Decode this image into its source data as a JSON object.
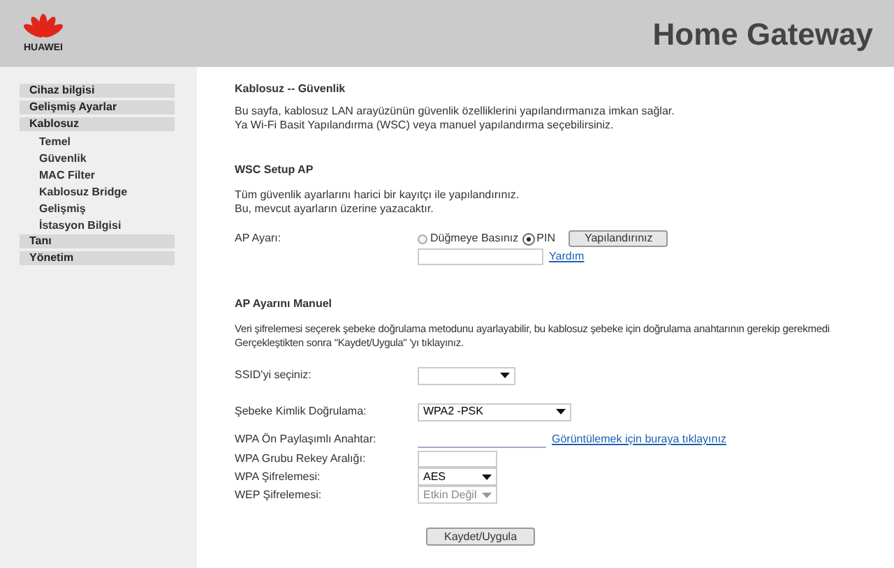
{
  "header": {
    "logo_text": "HUAWEI",
    "title": "Home Gateway"
  },
  "sidebar": {
    "items": [
      {
        "label": "Cihaz bilgisi"
      },
      {
        "label": "Gelişmiş Ayarlar"
      },
      {
        "label": "Kablosuz",
        "children": [
          {
            "label": "Temel"
          },
          {
            "label": "Güvenlik"
          },
          {
            "label": "MAC Filter"
          },
          {
            "label": "Kablosuz Bridge"
          },
          {
            "label": "Gelişmiş"
          },
          {
            "label": "İstasyon Bilgisi"
          }
        ]
      },
      {
        "label": "Tanı"
      },
      {
        "label": "Yönetim"
      }
    ]
  },
  "page": {
    "title": "Kablosuz -- Güvenlik",
    "description": [
      "Bu sayfa, kablosuz LAN arayüzünün güvenlik özelliklerini yapılandırmanıza imkan sağlar.",
      "Ya Wi-Fi Basit Yapılandırma (WSC) veya manuel yapılandırma seçebilirsiniz."
    ]
  },
  "wsc": {
    "heading": "WSC Setup AP",
    "description": [
      "Tüm güvenlik ayarlarını harici bir kayıtçı ile yapılandırınız.",
      "Bu, mevcut ayarların üzerine yazacaktır."
    ],
    "label": "AP Ayarı:",
    "options": [
      {
        "label": "Düğmeye Basınız",
        "selected": false
      },
      {
        "label": "PIN",
        "selected": true
      }
    ],
    "button": "Yapılandırınız",
    "help_link": "Yardım"
  },
  "manual": {
    "heading": "AP Ayarını Manuel",
    "description": [
      "Veri şifrelemesi seçerek şebeke doğrulama metodunu ayarlayabilir, bu kablosuz şebeke için doğrulama anahtarının gerekip gerekmedi",
      "Gerçekleştikten sonra \"Kaydet/Uygula\" 'yı tıklayınız."
    ],
    "rows": [
      {
        "kind": "select",
        "label": "SSID'yi seçiniz:"
      },
      {
        "kind": "wide-select",
        "label": "Şebeke Kimlik Doğrulama:",
        "value": "WPA2 -PSK"
      },
      {
        "kind": "password",
        "label": "WPA Ön Paylaşımlı Anahtar:",
        "link": "Görüntülemek için buraya tıklayınız"
      },
      {
        "kind": "field",
        "label": "WPA Grubu Rekey Aralığı:"
      },
      {
        "kind": "small-select",
        "label": "WPA Şifrelemesi:",
        "value": "AES"
      },
      {
        "kind": "disabled-select",
        "label": "WEP Şifrelemesi:",
        "value": "Etkin Değil"
      }
    ]
  },
  "save_button": "Kaydet/Uygula"
}
